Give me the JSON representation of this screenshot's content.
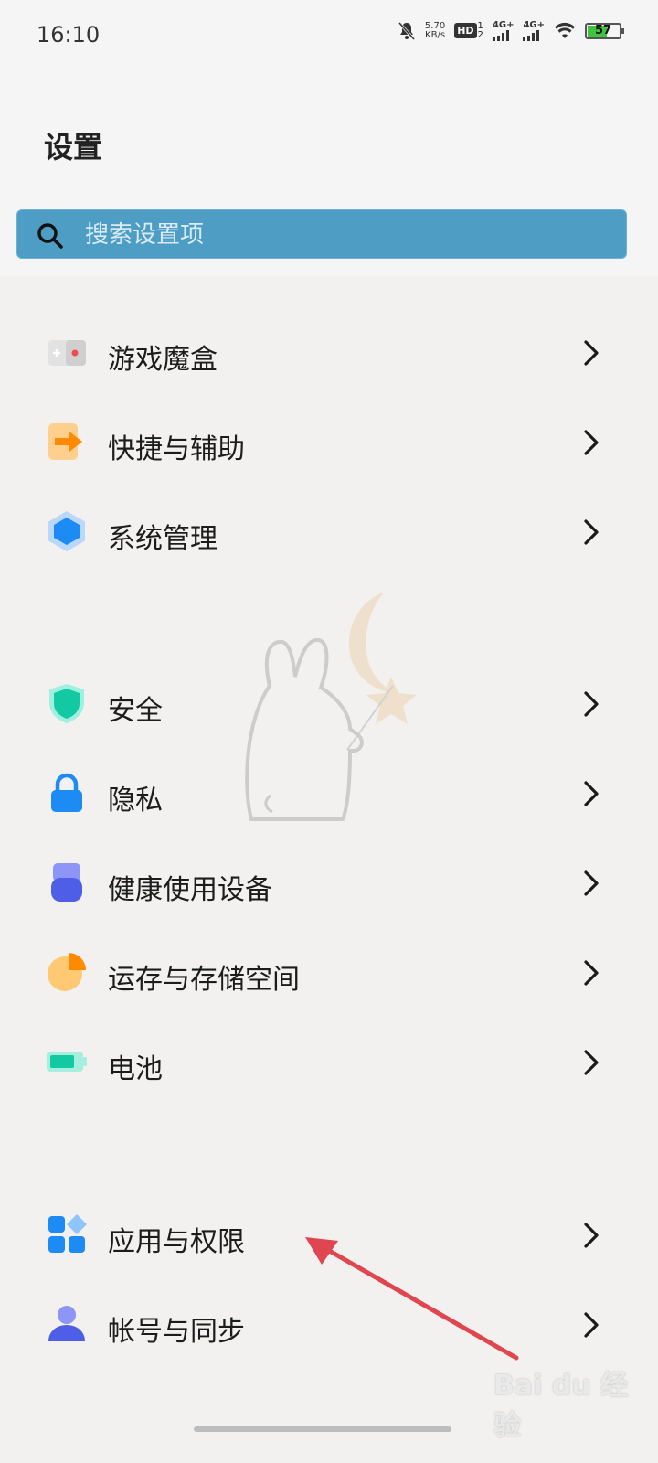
{
  "status_bar": {
    "time": "16:10",
    "speed_value": "5.70",
    "speed_unit": "KB/s",
    "hd_label": "HD",
    "hd_sub_top": "1",
    "hd_sub_bottom": "2",
    "sim1": "4G+",
    "sim2": "4G+",
    "battery": "57",
    "battery_level": 0.57,
    "icons": [
      "mute-bell-icon",
      "wifi-icon"
    ]
  },
  "header": {
    "title": "设置"
  },
  "search": {
    "placeholder": "搜索设置项"
  },
  "groups": [
    {
      "items": [
        {
          "label": "游戏魔盒",
          "icon": "game-box-icon"
        },
        {
          "label": "快捷与辅助",
          "icon": "shortcut-icon"
        },
        {
          "label": "系统管理",
          "icon": "system-hexagon-icon"
        }
      ]
    },
    {
      "items": [
        {
          "label": "安全",
          "icon": "shield-icon"
        },
        {
          "label": "隐私",
          "icon": "lock-icon"
        },
        {
          "label": "健康使用设备",
          "icon": "health-icon"
        },
        {
          "label": "运存与存储空间",
          "icon": "storage-pie-icon"
        },
        {
          "label": "电池",
          "icon": "battery-icon"
        }
      ]
    },
    {
      "items": [
        {
          "label": "应用与权限",
          "icon": "apps-grid-icon"
        },
        {
          "label": "帐号与同步",
          "icon": "account-icon"
        }
      ]
    }
  ],
  "watermark_text": "Bai du 经验",
  "colors": {
    "search_bg": "#4e9dc4",
    "arrow": "#e0464f",
    "accent_blue": "#1c8bf3"
  }
}
